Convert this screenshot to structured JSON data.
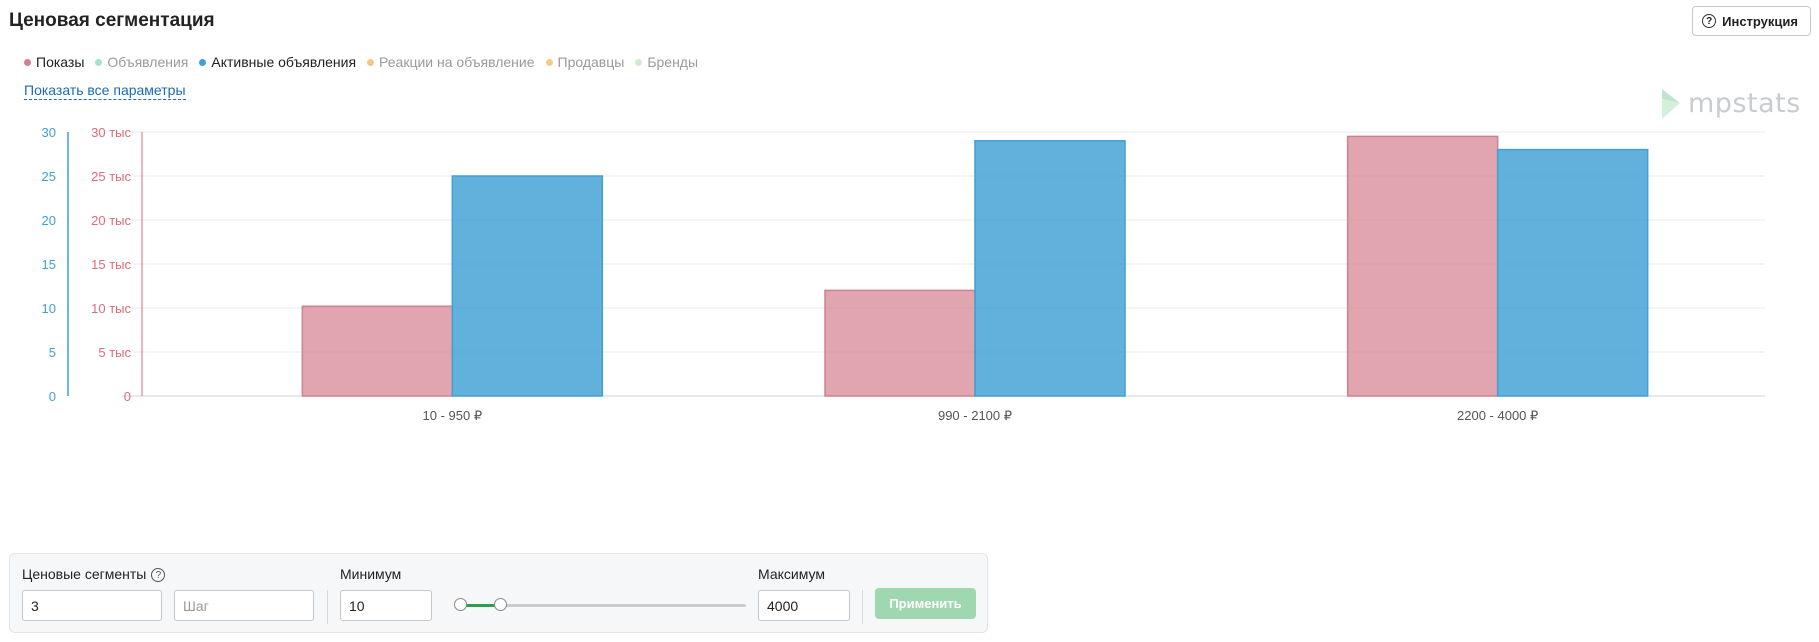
{
  "page": {
    "title": "Ценовая сегментация",
    "instruction_label": "Инструкция",
    "show_all_label": "Показать все параметры",
    "logo_text": "mpstats"
  },
  "legend": [
    {
      "label": "Показы",
      "color": "#d47f8f",
      "active": true
    },
    {
      "label": "Объявления",
      "color": "#a8e0cf",
      "active": false
    },
    {
      "label": "Активные объявления",
      "color": "#3fa0d4",
      "active": true
    },
    {
      "label": "Реакции на объявление",
      "color": "#f6c48a",
      "active": false
    },
    {
      "label": "Продавцы",
      "color": "#f5cc85",
      "active": false
    },
    {
      "label": "Бренды",
      "color": "#cdebcf",
      "active": false
    }
  ],
  "chart_data": {
    "type": "bar",
    "categories": [
      "10 - 950 ₽",
      "990 - 2100 ₽",
      "2200 - 4000 ₽"
    ],
    "series": [
      {
        "name": "Показы",
        "values": [
          10200,
          12000,
          29500
        ],
        "color": "#d47f8f",
        "axis": "right_scale"
      },
      {
        "name": "Активные объявления",
        "values": [
          25,
          29,
          28
        ],
        "color": "#3fa0d4",
        "axis": "left_scale"
      }
    ],
    "axes": {
      "left_scale": {
        "ylim": [
          0,
          30
        ],
        "ticks": [
          "0",
          "5",
          "10",
          "15",
          "20",
          "25",
          "30"
        ],
        "color": "#3fa0d4"
      },
      "right_scale": {
        "ylim": [
          0,
          30000
        ],
        "ticks": [
          "0",
          "5 тыс",
          "10 тыс",
          "15 тыс",
          "20 тыс",
          "25 тыс",
          "30 тыс"
        ],
        "color": "#e06a7c"
      }
    },
    "grid": true
  },
  "controls": {
    "segments_label": "Ценовые сегменты",
    "segments_value": "3",
    "step_placeholder": "Шаг",
    "min_label": "Минимум",
    "min_value": "10",
    "max_label": "Максимум",
    "max_value": "4000",
    "slider_min_fraction": 0,
    "slider_max_fraction": 0.14,
    "apply_label": "Применить"
  }
}
